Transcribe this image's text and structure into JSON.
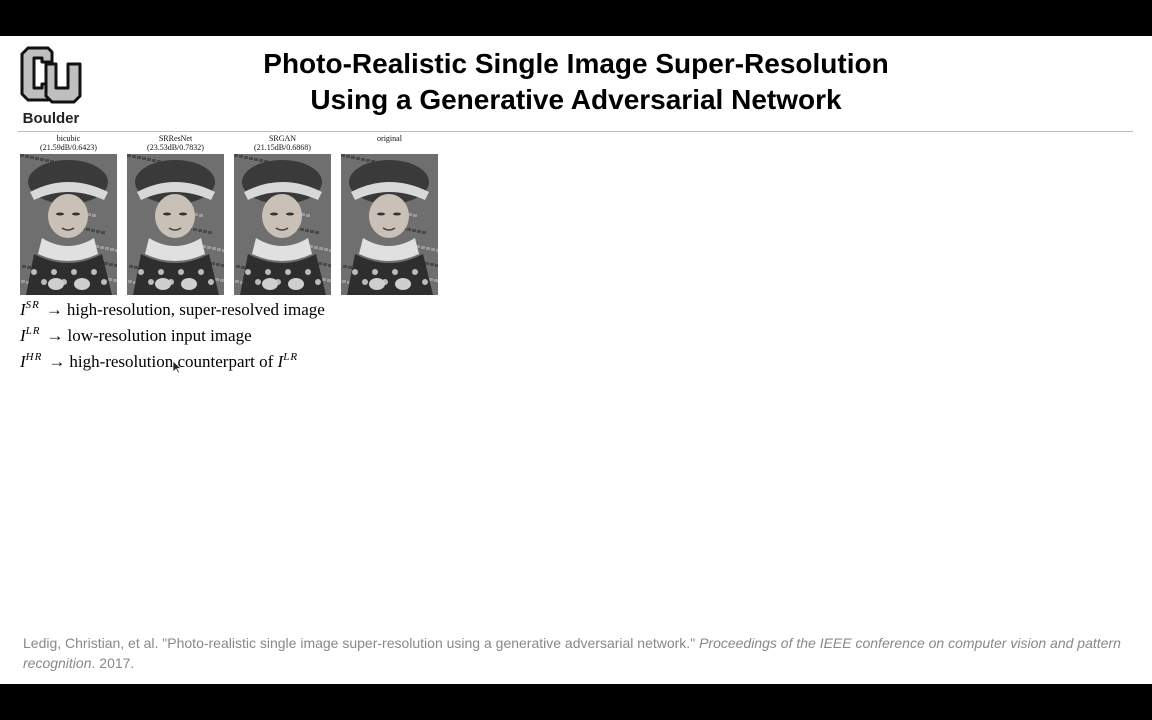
{
  "logo": {
    "text": "Boulder",
    "icon": "cu-logo-icon",
    "colors": {
      "fill": "#bfbfbf",
      "stroke": "#111111"
    }
  },
  "title": {
    "line1": "Photo-Realistic Single Image Super-Resolution",
    "line2": "Using a Generative Adversarial Network"
  },
  "figure": {
    "panels": [
      {
        "label": "bicubic",
        "metrics": "(21.59dB/0.6423)"
      },
      {
        "label": "SRResNet",
        "metrics": "(23.53dB/0.7832)"
      },
      {
        "label": "SRGAN",
        "metrics": "(21.15dB/0.6868)"
      },
      {
        "label": "original",
        "metrics": ""
      }
    ]
  },
  "definitions": [
    {
      "symbol": "I",
      "sup": "SR",
      "arrow": "→",
      "text": "high-resolution, super-resolved image"
    },
    {
      "symbol": "I",
      "sup": "LR",
      "arrow": "→",
      "text": "low-resolution input image"
    },
    {
      "symbol": "I",
      "sup": "HR",
      "arrow": "→",
      "text": "high-resolution counterpart of",
      "ref_symbol": "I",
      "ref_sup": "LR"
    }
  ],
  "citation": {
    "authors_title": "Ledig, Christian, et al. \"Photo-realistic single image super-resolution using a generative adversarial network.\"",
    "venue": "Proceedings of the IEEE conference on computer vision and pattern recognition",
    "year": ". 2017."
  },
  "cursor": {
    "icon": "mouse-pointer-icon"
  }
}
